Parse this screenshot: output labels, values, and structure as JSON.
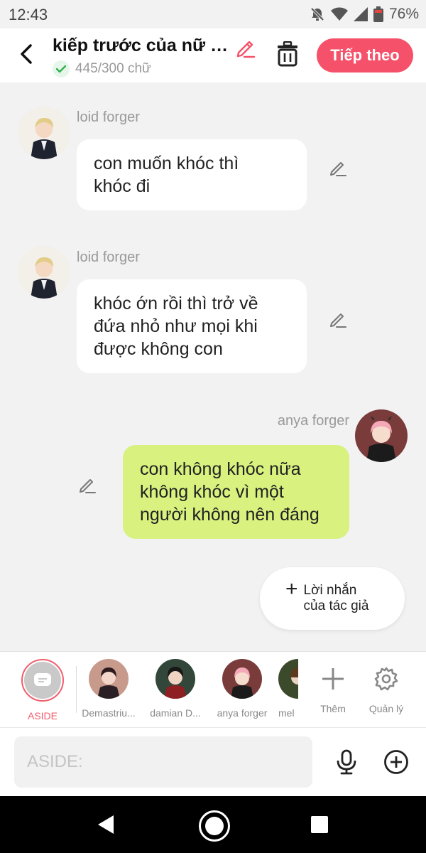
{
  "status": {
    "time": "12:43",
    "battery": "76%"
  },
  "header": {
    "title": "kiếp trước của nữ c...",
    "word_count": "445/300 chữ",
    "next_label": "Tiếp theo"
  },
  "messages": [
    {
      "sender": "loid forger",
      "line1": "con muốn khóc thì",
      "line2": "khóc đi",
      "line3": ""
    },
    {
      "sender": "loid forger",
      "line1": "khóc ớn rồi thì trở về",
      "line2": "đứa nhỏ như mọi khi",
      "line3": "được không con"
    },
    {
      "sender": "anya forger",
      "line1": "con không khóc nữa",
      "line2": "không khóc vì một",
      "line3": "người không nên đáng"
    }
  ],
  "author_note": {
    "line1": "Lời nhắn",
    "line2": "của tác giả"
  },
  "cast": [
    {
      "label": "ASIDE"
    },
    {
      "label": "Demastriu..."
    },
    {
      "label": "damian D..."
    },
    {
      "label": "anya forger"
    },
    {
      "label": "mel"
    },
    {
      "label": "Thêm"
    },
    {
      "label": "Quản lý"
    }
  ],
  "input": {
    "placeholder": "ASIDE:"
  },
  "colors": {
    "accent": "#f6516a",
    "my_bubble": "#d8f17f",
    "aside_ring": "#f25d6d"
  }
}
